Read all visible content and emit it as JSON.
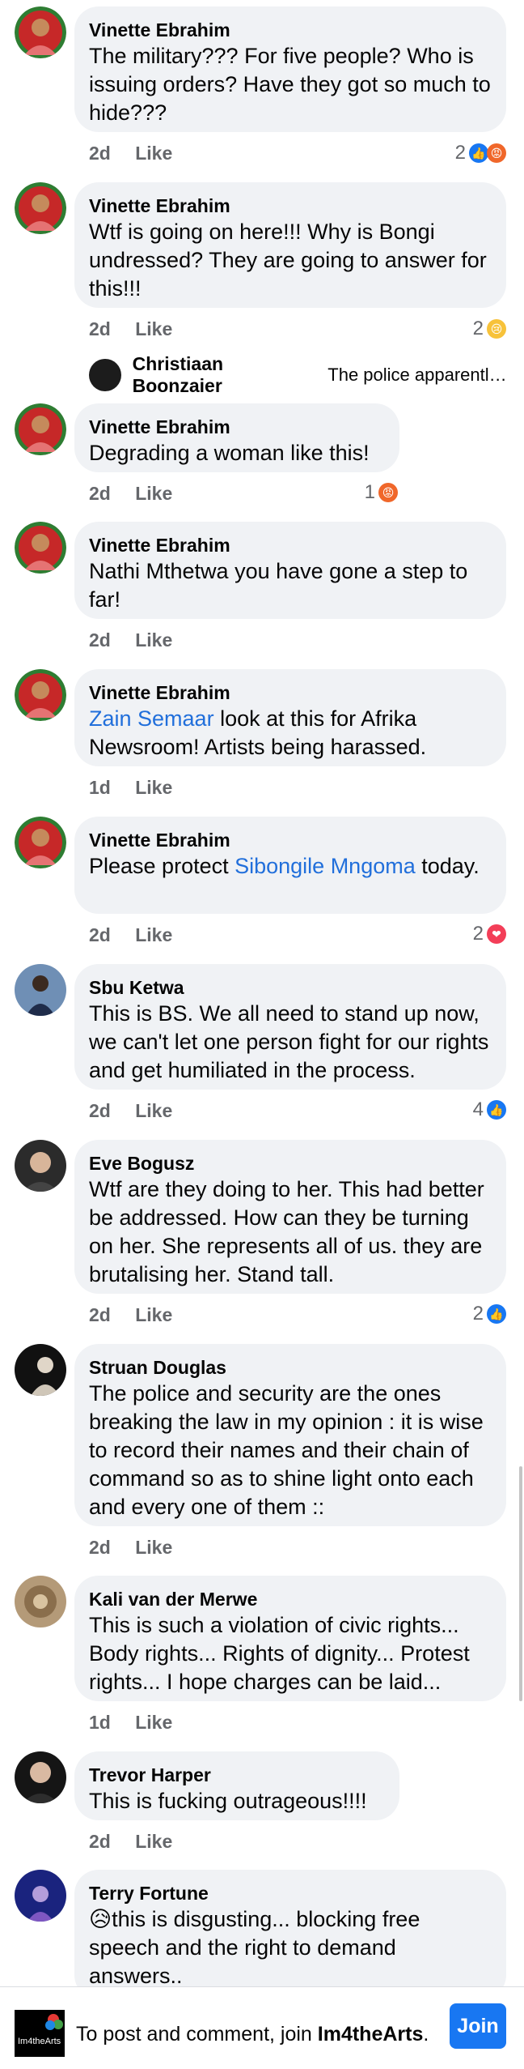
{
  "colors": {
    "mention": "#216fdb",
    "bubble": "#f0f2f5",
    "primary": "#1877f2"
  },
  "comments": [
    {
      "author": "Vinette Ebrahim",
      "text": "The military??? For five people? Who is issuing orders? Have they got so much to hide???",
      "time": "2d",
      "like": "Like",
      "reactions": "2",
      "reaction_icons": [
        "like-icon",
        "angry-icon"
      ]
    },
    {
      "author": "Vinette Ebrahim",
      "text": "Wtf is going on here!!! Why is Bongi undressed? They are going to answer for this!!!",
      "time": "2d",
      "like": "Like",
      "reactions": "2",
      "reaction_icons": [
        "sad-icon"
      ]
    },
    {
      "author": "Vinette Ebrahim",
      "text": "Degrading a woman like this!",
      "time": "2d",
      "like": "Like",
      "reactions": "1",
      "reaction_icons": [
        "angry-icon"
      ]
    },
    {
      "author": "Vinette Ebrahim",
      "text": "Nathi Mthetwa you have gone a step to far!",
      "time": "2d",
      "like": "Like"
    },
    {
      "author": "Vinette Ebrahim",
      "mention": "Zain Semaar",
      "text": " look at this for Afrika Newsroom! Artists being harassed.",
      "time": "1d",
      "like": "Like"
    },
    {
      "author": "Vinette Ebrahim",
      "text_before": "Please protect ",
      "mention": "Sibongile Mngoma",
      "text_after": " today.",
      "time": "2d",
      "like": "Like",
      "reactions": "2",
      "reaction_icons": [
        "love-icon"
      ]
    },
    {
      "author": "Sbu Ketwa",
      "text": "This is BS. We all need to stand up now, we can't let one person fight for our rights and get humiliated in the process.",
      "time": "2d",
      "like": "Like",
      "reactions": "4",
      "reaction_icons": [
        "like-icon"
      ]
    },
    {
      "author": "Eve Bogusz",
      "text": "Wtf are they doing to her. This had better be addressed. How can they be turning on her. She represents all of us. they are brutalising her. Stand tall.",
      "time": "2d",
      "like": "Like",
      "reactions": "2",
      "reaction_icons": [
        "like-icon"
      ]
    },
    {
      "author": "Struan Douglas",
      "text": "The police and security are the ones breaking the law in my opinion : it is wise to record their names and their chain of command so as to shine light onto each and every one of them ::",
      "time": "2d",
      "like": "Like"
    },
    {
      "author": "Kali van der Merwe",
      "text": "This is such a violation of civic rights... Body rights... Rights of dignity... Protest rights... I hope charges can be laid...",
      "time": "1d",
      "like": "Like"
    },
    {
      "author": "Trevor Harper",
      "text": "This is fucking outrageous!!!!",
      "time": "2d",
      "like": "Like"
    },
    {
      "author": "Terry Fortune",
      "text": "😥this is disgusting... blocking free speech and the right to demand answers..",
      "time": "",
      "like": ""
    }
  ],
  "reply_preview": {
    "author": "Christiaan Boonzaier",
    "text": "The police apparently..."
  },
  "footer": {
    "group_logo_text": "Im4theArts",
    "prompt_before": "To post and comment, join ",
    "group_name": "Im4theArts",
    "prompt_after": ".",
    "join_label": "Join"
  }
}
